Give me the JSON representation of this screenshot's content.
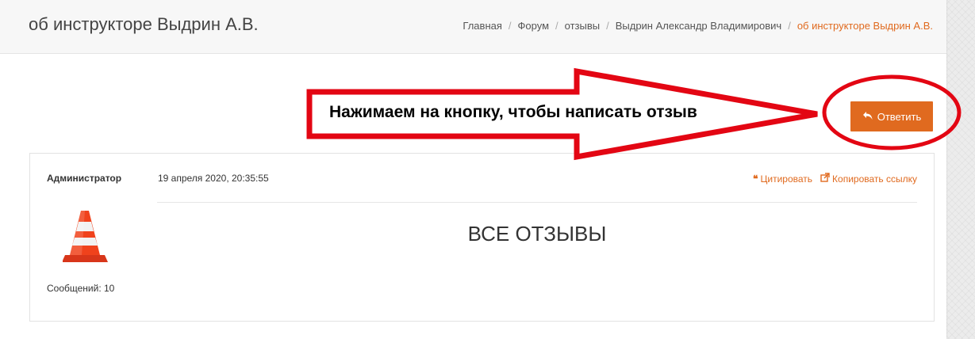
{
  "header": {
    "title": "об инструкторе Выдрин А.В.",
    "breadcrumb": [
      "Главная",
      "Форум",
      "отзывы",
      "Выдрин Александр Владимирович"
    ],
    "breadcrumb_active": "об инструкторе Выдрин А.В.",
    "breadcrumb_separator": "/"
  },
  "toolbar": {
    "reply_label": "Ответить",
    "reply_icon": "reply-icon"
  },
  "annotation": {
    "text": "Нажимаем на кнопку, чтобы написать отзыв",
    "color": "#e30613"
  },
  "post": {
    "author": "Администратор",
    "avatar": "traffic-cone-icon",
    "message_count": "Сообщений: 10",
    "date": "19 апреля 2020, 20:35:55",
    "quote_label": "Цитировать",
    "copy_link_label": "Копировать ссылку",
    "body": "ВСЕ ОТЗЫВЫ"
  },
  "colors": {
    "accent": "#e06a1f",
    "annotation": "#e30613"
  }
}
